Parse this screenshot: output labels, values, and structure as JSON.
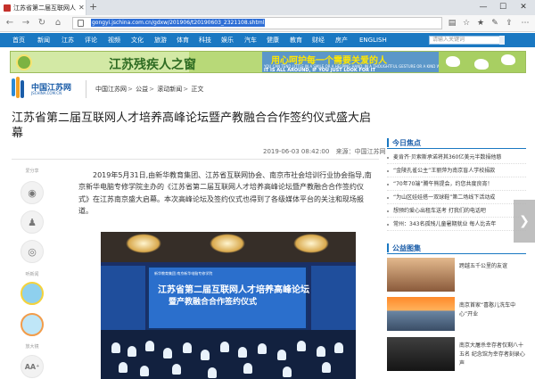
{
  "browser": {
    "tab_title": "江苏省第二届互联网人才",
    "url": "gongyi.jschina.com.cn/gdxw/201906/t20190603_2321108.shtml"
  },
  "site_nav": {
    "items": [
      "首页",
      "新闻",
      "江苏",
      "评论",
      "视频",
      "文化",
      "旅游",
      "体育",
      "科技",
      "娱乐",
      "汽车",
      "健康",
      "教育",
      "财经",
      "房产",
      "ENGLISH"
    ],
    "search_placeholder": "请输入关键词"
  },
  "banner": {
    "title": "江苏残疾人之窗",
    "slogan_cn": "用心呵护每一个需要关爱的人",
    "slogan_en_small": "YOU CAN TEND LITTLE IN A SMILE OR A HELPING HAND, IN A THOUGHTFUL GESTURE OR A KIND WORD",
    "slogan_en_big": "IT IS ALL AROUND, IF YOU JUST LOOK FOR IT"
  },
  "logo": {
    "name": "中国江苏网",
    "domain": "JSCHINA.COM.CN"
  },
  "breadcrumb": [
    "中国江苏网",
    "公益",
    "滚动新闻",
    "正文"
  ],
  "article": {
    "headline": "江苏省第二届互联网人才培养高峰论坛暨产教融合合作签约仪式盛大启幕",
    "date": "2019-06-03 08:42:00",
    "source_label": "来源：",
    "source": "中国江苏网",
    "paragraph": "2019年5月31日,由新华教育集团、江苏省互联网协会、南京市社会培训行业协会指导,南京新华电脑专修学院主办的《江苏省第二届互联网人才培养高峰论坛暨产教融合合作签约仪式》在江苏南京盛大启幕。本次高峰论坛及签约仪式也得到了各级媒体平台的关注和现场报道。",
    "photo_screen_line1": "江苏省第二届互联网人才培养高峰论坛",
    "photo_screen_line2": "暨产教融合合作签约仪式",
    "photo_screen_top": "新华教育集团 南京新华电脑专修学院"
  },
  "share": {
    "label": "爱分享",
    "label2": "听新闻",
    "label3": "放大镜",
    "zoom_glyph": "AA⁺"
  },
  "sidebar": {
    "focus_title": "今日焦点",
    "focus_items": [
      "麦肯齐·贝索斯承诺将其360亿美元半数捐他慈",
      "“金陵孔雀公主”王丽萍为南京盲人学校捐款",
      "“70年70端”腾午熊提会，约您共度良宵！",
      "“为山区娃娃搭一双球鞋”第二场线下活动成",
      "想预约爱心出租车送考 打我们的电话吧",
      "常州：343名孤残儿童暑期就业 每人比去年"
    ],
    "gallery_title": "公益图集",
    "gallery_items": [
      "跨越五千公里的友谊",
      "南京首家“喜憨儿洗车中心”开业",
      "南京大屠杀幸存者仅剩八十五名 纪念馆为幸存者刻录心声"
    ]
  },
  "colors": {
    "nav_blue": "#1a78c2",
    "banner_green": "#b8d978",
    "heading_blue": "#1a5da8"
  }
}
